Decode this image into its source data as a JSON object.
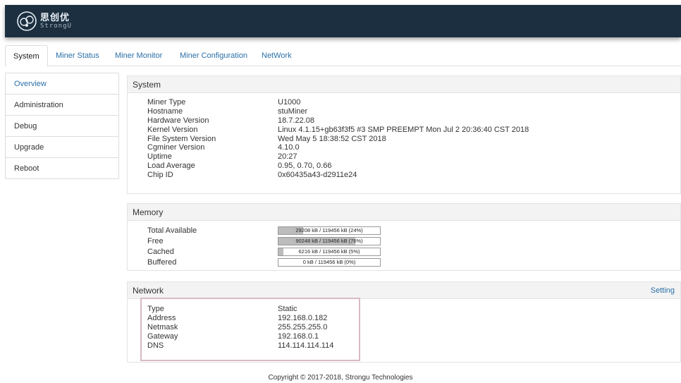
{
  "brand": {
    "name_cn": "思创优",
    "name_en": "StrongU"
  },
  "tabs": [
    {
      "label": "System",
      "active": true
    },
    {
      "label": "Miner Status"
    },
    {
      "label": "Miner Monitor"
    },
    {
      "label": "Miner Configuration"
    },
    {
      "label": "NetWork"
    }
  ],
  "sidebar": {
    "items": [
      {
        "label": "Overview",
        "active": true
      },
      {
        "label": "Administration"
      },
      {
        "label": "Debug"
      },
      {
        "label": "Upgrade"
      },
      {
        "label": "Reboot"
      }
    ]
  },
  "system": {
    "title": "System",
    "rows": [
      {
        "key": "Miner Type",
        "value": "U1000"
      },
      {
        "key": "Hostname",
        "value": "stuMiner"
      },
      {
        "key": "Hardware Version",
        "value": "18.7.22.08"
      },
      {
        "key": "Kernel Version",
        "value": "Linux 4.1.15+gb63f3f5 #3 SMP PREEMPT Mon Jul 2 20:36:40 CST 2018"
      },
      {
        "key": "File System Version",
        "value": "Wed May 5 18:38:52 CST 2018"
      },
      {
        "key": "Cgminer Version",
        "value": "4.10.0"
      },
      {
        "key": "Uptime",
        "value": "20:27"
      },
      {
        "key": "Load Average",
        "value": "0.95, 0.70, 0.66"
      },
      {
        "key": "Chip ID",
        "value": "0x60435a43-d2911e24"
      }
    ]
  },
  "memory": {
    "title": "Memory",
    "rows": [
      {
        "key": "Total Available",
        "text": "29208 kB / 119456 kB (24%)",
        "percent": 24
      },
      {
        "key": "Free",
        "text": "90248 kB / 119456 kB (76%)",
        "percent": 76
      },
      {
        "key": "Cached",
        "text": "6216 kB / 119456 kB (5%)",
        "percent": 5
      },
      {
        "key": "Buffered",
        "text": "0 kB / 119456 kB (0%)",
        "percent": 0
      }
    ]
  },
  "network": {
    "title": "Network",
    "setting_label": "Setting",
    "rows": [
      {
        "key": "Type",
        "value": "Static"
      },
      {
        "key": "Address",
        "value": "192.168.0.182"
      },
      {
        "key": "Netmask",
        "value": "255.255.255.0"
      },
      {
        "key": "Gateway",
        "value": "192.168.0.1"
      },
      {
        "key": "DNS",
        "value": "114.114.114.114"
      }
    ]
  },
  "footer": {
    "text": "Copyright © 2017-2018, Strongu Technologies"
  },
  "colors": {
    "topbar": "#1b2f40",
    "link": "#2a6fa8",
    "highlight_border": "#d9b9c6",
    "bar_fill": "#bcbcbc"
  }
}
